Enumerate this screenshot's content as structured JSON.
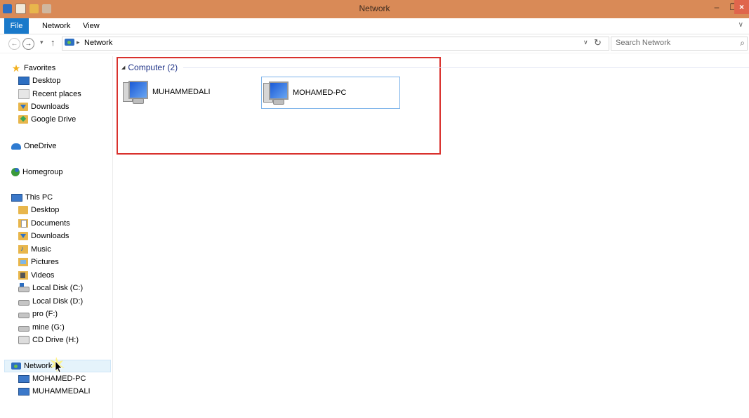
{
  "window": {
    "title": "Network",
    "minimize": "–",
    "maximize": "❐",
    "close": "×"
  },
  "ribbon": {
    "tabs": [
      "File",
      "Network",
      "View"
    ],
    "expand": "∨"
  },
  "address": {
    "back": "←",
    "forward": "→",
    "recent": "▾",
    "up": "↑",
    "separator": "▸",
    "crumb": "Network",
    "dropdown": "∨",
    "refresh": "↻"
  },
  "search": {
    "placeholder": "Search Network",
    "icon": "search-icon"
  },
  "sidebar": {
    "favorites": {
      "label": "Favorites",
      "items": [
        "Desktop",
        "Recent places",
        "Downloads",
        "Google Drive"
      ]
    },
    "onedrive": "OneDrive",
    "homegroup": "Homegroup",
    "thispc": {
      "label": "This PC",
      "items": [
        "Desktop",
        "Documents",
        "Downloads",
        "Music",
        "Pictures",
        "Videos",
        "Local Disk (C:)",
        "Local Disk (D:)",
        "pro (F:)",
        "mine (G:)",
        "CD Drive (H:)"
      ]
    },
    "network": {
      "label": "Network",
      "items": [
        "MOHAMED-PC",
        "MUHAMMEDALI"
      ]
    }
  },
  "content": {
    "group_label": "Computer (2)",
    "computers": [
      "MUHAMMEDALI",
      "MOHAMED-PC"
    ]
  },
  "colors": {
    "titlebar": "#d98a57",
    "file_tab": "#1979ca",
    "highlight_border": "#d9312d",
    "group_header": "#1e3287"
  }
}
